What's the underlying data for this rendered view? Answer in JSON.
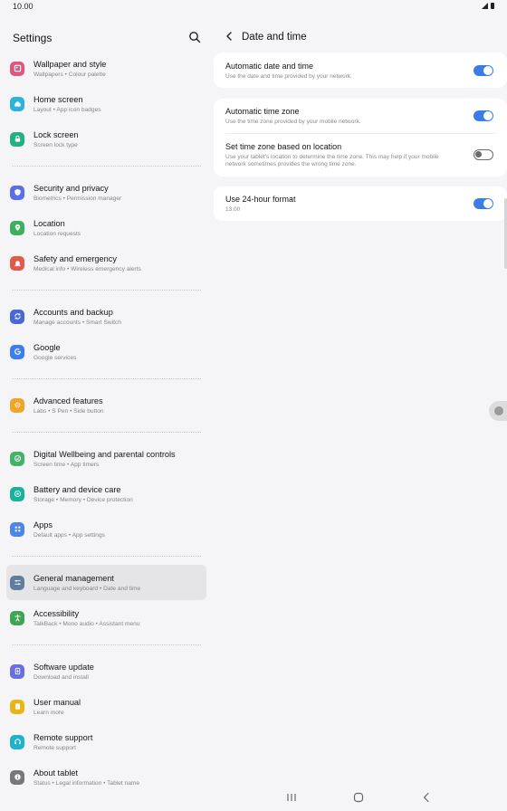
{
  "status_bar": {
    "time": "10.00"
  },
  "left": {
    "title": "Settings",
    "groups": [
      [
        {
          "title": "Wallpaper and style",
          "subtitle": "Wallpapers  •  Colour palette",
          "color": "#e0577d",
          "icon": "wallpaper-icon"
        },
        {
          "title": "Home screen",
          "subtitle": "Layout  •  App icon badges",
          "color": "#2cb3d9",
          "icon": "home-icon"
        },
        {
          "title": "Lock screen",
          "subtitle": "Screen lock type",
          "color": "#23b184",
          "icon": "lock-icon"
        }
      ],
      [
        {
          "title": "Security and privacy",
          "subtitle": "Biometrics  •  Permission manager",
          "color": "#5b6ee8",
          "icon": "shield-icon"
        },
        {
          "title": "Location",
          "subtitle": "Location requests",
          "color": "#3db05f",
          "icon": "location-icon"
        },
        {
          "title": "Safety and emergency",
          "subtitle": "Medical info  •  Wireless emergency alerts",
          "color": "#e25a4c",
          "icon": "emergency-icon"
        }
      ],
      [
        {
          "title": "Accounts and backup",
          "subtitle": "Manage accounts  •  Smart Switch",
          "color": "#4a69d6",
          "icon": "sync-icon"
        },
        {
          "title": "Google",
          "subtitle": "Google services",
          "color": "#3c7ef0",
          "icon": "google-icon"
        }
      ],
      [
        {
          "title": "Advanced features",
          "subtitle": "Labs  •  S Pen  •  Side button",
          "color": "#f0a528",
          "icon": "gear-plus-icon"
        }
      ],
      [
        {
          "title": "Digital Wellbeing and parental controls",
          "subtitle": "Screen time  •  App timers",
          "color": "#44b36a",
          "icon": "wellbeing-icon"
        },
        {
          "title": "Battery and device care",
          "subtitle": "Storage  •  Memory  •  Device protection",
          "color": "#19b39a",
          "icon": "device-care-icon"
        },
        {
          "title": "Apps",
          "subtitle": "Default apps  •  App settings",
          "color": "#4b86e8",
          "icon": "apps-grid-icon"
        }
      ],
      [
        {
          "title": "General management",
          "subtitle": "Language and keyboard  •  Date and time",
          "color": "#5f7e9e",
          "icon": "sliders-icon",
          "active": true
        },
        {
          "title": "Accessibility",
          "subtitle": "TalkBack  •  Mono audio  •  Assistant menu",
          "color": "#3fa456",
          "icon": "accessibility-icon"
        }
      ],
      [
        {
          "title": "Software update",
          "subtitle": "Download and install",
          "color": "#6a6fe0",
          "icon": "update-icon"
        },
        {
          "title": "User manual",
          "subtitle": "Learn more",
          "color": "#e8b418",
          "icon": "manual-icon"
        },
        {
          "title": "Remote support",
          "subtitle": "Remote support",
          "color": "#1fb2cc",
          "icon": "headset-icon"
        },
        {
          "title": "About tablet",
          "subtitle": "Status  •  Legal information  •  Tablet name",
          "color": "#787878",
          "icon": "info-icon"
        }
      ]
    ]
  },
  "right": {
    "title": "Date and time",
    "auto_date": {
      "title": "Automatic date and time",
      "subtitle": "Use the date and time provided by your network.",
      "on": true
    },
    "auto_zone": {
      "title": "Automatic time zone",
      "subtitle": "Use the time zone provided by your mobile network.",
      "on": true
    },
    "zone_location": {
      "title": "Set time zone based on location",
      "subtitle": "Use your tablet's location to determine the time zone. This may help if your mobile network sometimes provides the wrong time zone.",
      "on": false
    },
    "h24": {
      "title": "Use 24-hour format",
      "subtitle": "13:00",
      "on": true
    }
  },
  "accent_color": "#3a7de8"
}
